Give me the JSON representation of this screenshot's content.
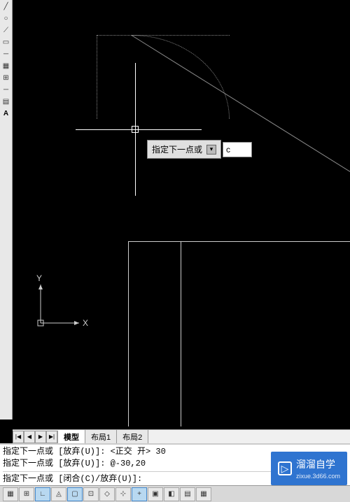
{
  "toolbar": {
    "icons": [
      "line",
      "circle",
      "polyline",
      "rect",
      "divider",
      "hatch",
      "array",
      "divider2",
      "table",
      "text"
    ]
  },
  "prompt": {
    "label": "指定下一点或",
    "input_value": "c"
  },
  "ucs": {
    "x_label": "X",
    "y_label": "Y"
  },
  "tabs": {
    "nav": [
      "|◀",
      "◀",
      "▶",
      "▶|"
    ],
    "items": [
      {
        "label": "模型",
        "active": true
      },
      {
        "label": "布局1",
        "active": false
      },
      {
        "label": "布局2",
        "active": false
      }
    ]
  },
  "command": {
    "history": [
      "指定下一点或 [放弃(U)]:  <正交 开> 30",
      "指定下一点或 [放弃(U)]: @-30,20"
    ],
    "prompt": "指定下一点或 [闭合(C)/放弃(U)]:"
  },
  "status": {
    "buttons": [
      "▦",
      "⊞",
      "∟",
      "◬",
      "▢",
      "⊡",
      "◇",
      "⊹",
      "+",
      "▣",
      "◧",
      "▤",
      "▦"
    ]
  },
  "watermark": {
    "brand": "溜溜自学",
    "url": "zixue.3d66.com"
  }
}
